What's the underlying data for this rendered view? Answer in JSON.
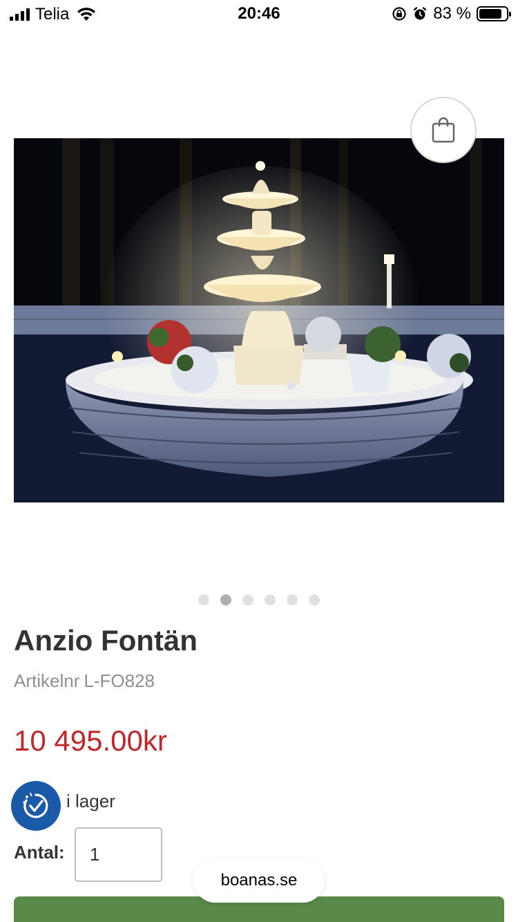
{
  "status_bar": {
    "carrier": "Telia",
    "time": "20:46",
    "battery_percent": "83 %",
    "battery_level": 0.83
  },
  "cart": {
    "icon": "shopping-bag-icon"
  },
  "gallery": {
    "image": "fountain-photo",
    "slide_count": 6,
    "active_slide": 2
  },
  "product": {
    "title": "Anzio Fontän",
    "sku_label": "Artikelnr",
    "sku": "L-FO828",
    "price": "10 495.00kr",
    "stock_text": "i lager",
    "stock_icon": "in-stock-icon"
  },
  "quantity": {
    "label": "Antal:",
    "value": "1"
  },
  "browser": {
    "url": "boanas.se"
  },
  "colors": {
    "price": "#c0262a",
    "stock_badge": "#1a5aa8",
    "buy_button": "#5a8a4a"
  }
}
